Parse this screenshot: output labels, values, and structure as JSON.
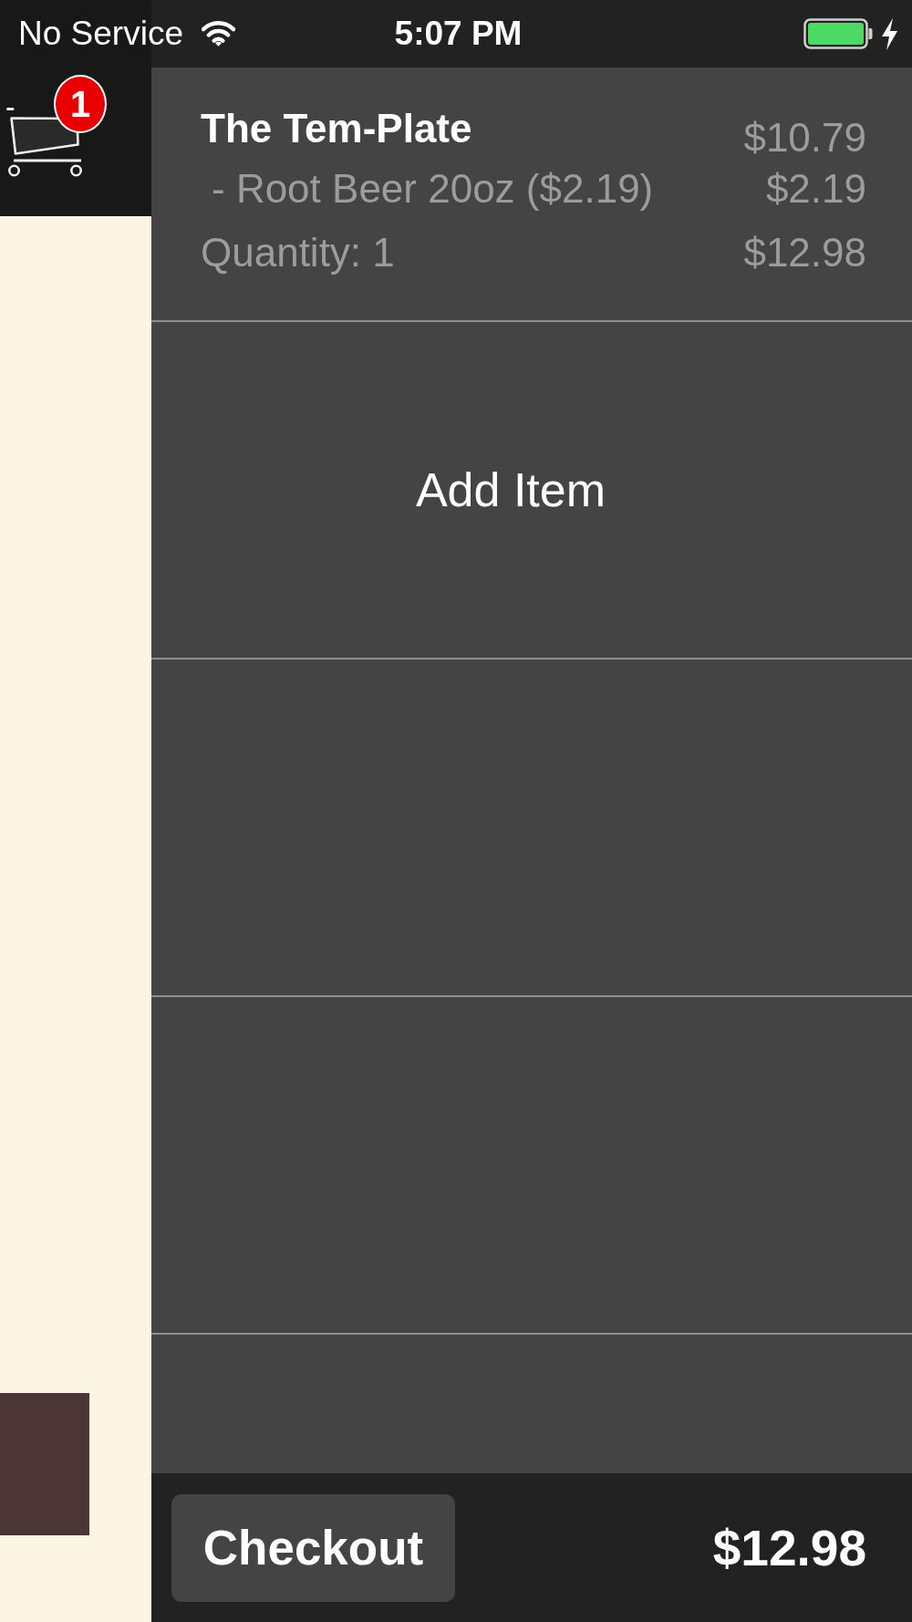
{
  "status_bar": {
    "carrier": "No Service",
    "time": "5:07 PM",
    "charging": true
  },
  "cart": {
    "badge": "1"
  },
  "cart_rows": [
    {
      "kind": "order_item",
      "name": "The Tem-Plate",
      "price": "$10.79",
      "options": [
        {
          "label": "- Root Beer 20oz ($2.19)",
          "price": "$2.19"
        }
      ],
      "quantity": "Quantity: 1",
      "total": "$12.98"
    },
    {
      "kind": "add_item",
      "label": "Add Item"
    },
    {
      "kind": "empty"
    },
    {
      "kind": "empty"
    }
  ],
  "footer": {
    "checkout_button": "Checkout",
    "total": "$12.98"
  }
}
